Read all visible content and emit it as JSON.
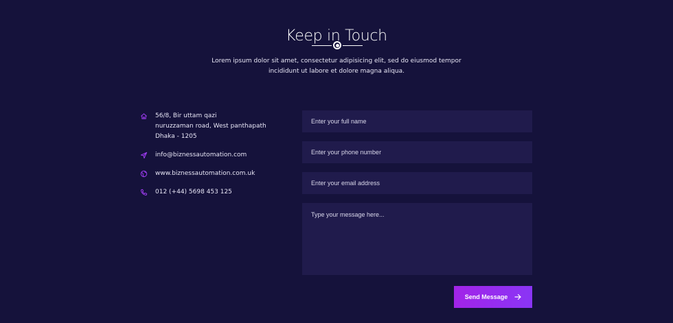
{
  "section": {
    "title": "Keep in Touch",
    "subtitle": "Lorem ipsum dolor sit amet, consectetur adipisicing elit, sed do eiusmod tempor incididunt ut labore et dolore magna aliqua."
  },
  "contact": {
    "address": {
      "icon": "home-icon",
      "line1": "56/8, Bir uttam qazi",
      "line2": "nuruzzaman road, West panthapath",
      "line3": "Dhaka - 1205"
    },
    "email": {
      "icon": "send-icon",
      "value": "info@biznessautomation.com"
    },
    "website": {
      "icon": "globe-icon",
      "value": "www.biznessautomation.com.uk"
    },
    "phone": {
      "icon": "phone-icon",
      "value": "012 (+44) 5698 453 125"
    }
  },
  "form": {
    "name_placeholder": "Enter your full name",
    "phone_placeholder": "Enter your phone number",
    "email_placeholder": "Enter your email address",
    "message_placeholder": "Type your message here...",
    "submit_label": "Send Message",
    "submit_icon": "arrow-right-icon"
  },
  "colors": {
    "background": "#15123b",
    "field_background": "#201b4c",
    "accent_start": "#a224e8",
    "accent_end": "#8a35f5",
    "icon_accent": "#9d3cf0"
  }
}
